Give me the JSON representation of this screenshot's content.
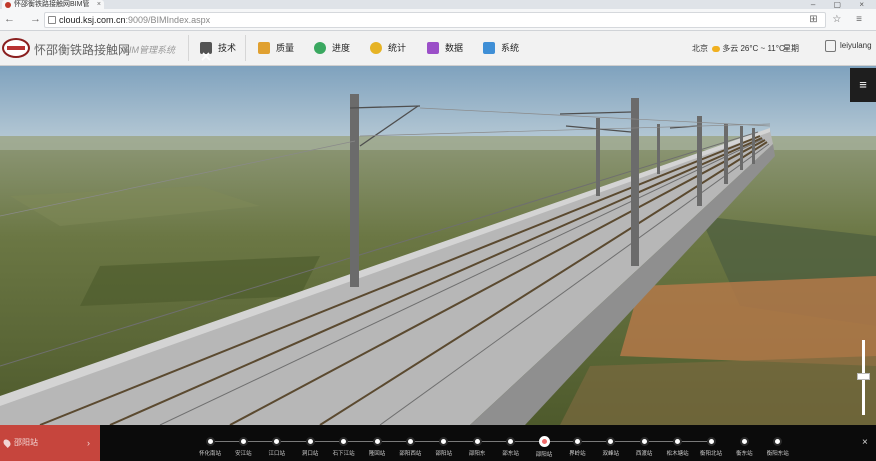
{
  "browser": {
    "tab_title": "怀邵衡铁路接触网BIM管",
    "tab_close": "×",
    "window_controls": "– ▢ ×",
    "url_host": "cloud.ksj.com.cn",
    "url_path": ":9009/BIMIndex.aspx",
    "nav_icons": "← → ↻",
    "right_icons": "⊞ ☆ ≡"
  },
  "app": {
    "brand": "怀邵衡铁路接触网",
    "subbrand": "BIM管理系统",
    "menu": [
      {
        "label": "技术",
        "icon": "tools-icon",
        "color": "#555555"
      },
      {
        "label": "质量",
        "icon": "clipboard-icon",
        "color": "#e0a030"
      },
      {
        "label": "进度",
        "icon": "clock-icon",
        "color": "#3aa860"
      },
      {
        "label": "统计",
        "icon": "coin-icon",
        "color": "#e6b325"
      },
      {
        "label": "数据",
        "icon": "layers-icon",
        "color": "#9b4fc8"
      },
      {
        "label": "系统",
        "icon": "monitor-icon",
        "color": "#3f8fd6"
      }
    ],
    "weather": {
      "city": "北京",
      "condition": "多云 26°C ~ 11°C",
      "weekday": "星期"
    },
    "user": "leiyulang"
  },
  "scene": {
    "menu_toggle": "≡",
    "sky_color": "#8fb0c8",
    "ground_color": "#5f6b3a"
  },
  "station_bar": {
    "current_station": "邵阳站",
    "current_arrow": "›",
    "close": "×",
    "stations": [
      "怀化南站",
      "安江站",
      "江口站",
      "洞口站",
      "石下江站",
      "隆回站",
      "邵阳西站",
      "邵阳站",
      "邵阳东",
      "邵东站",
      "邵阳站",
      "界岭站",
      "双峰站",
      "西渡站",
      "松木塘站",
      "衡阳北站",
      "衡东站",
      "衡阳东站"
    ],
    "active_index": 10
  }
}
